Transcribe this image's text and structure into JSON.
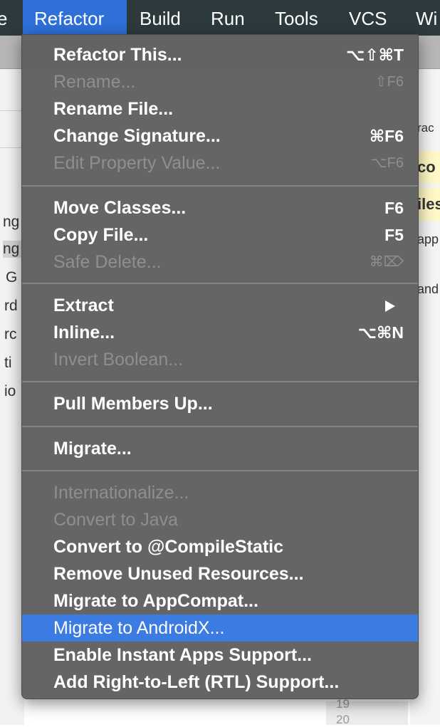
{
  "menubar": {
    "items": [
      {
        "label": "e"
      },
      {
        "label": "Refactor"
      },
      {
        "label": "Build"
      },
      {
        "label": "Run"
      },
      {
        "label": "Tools"
      },
      {
        "label": "VCS"
      },
      {
        "label": "Wi"
      }
    ]
  },
  "background": {
    "left_fragments": [
      "ng",
      "ng",
      "G",
      "rd",
      "rc",
      "ti",
      "io"
    ],
    "right_fragments": [
      "rac",
      "co",
      "iles",
      "app",
      "and"
    ],
    "line_numbers": [
      "19",
      "20"
    ]
  },
  "menu": {
    "items": [
      {
        "label": "Refactor This...",
        "shortcut": "⌥⇧⌘T",
        "disabled": false
      },
      {
        "label": "Rename...",
        "shortcut": "⇧F6",
        "disabled": true
      },
      {
        "label": "Rename File...",
        "shortcut": "",
        "disabled": false
      },
      {
        "label": "Change Signature...",
        "shortcut": "⌘F6",
        "disabled": false
      },
      {
        "label": "Edit Property Value...",
        "shortcut": "⌥F6",
        "disabled": true
      },
      {
        "label": "Move Classes...",
        "shortcut": "F6",
        "disabled": false
      },
      {
        "label": "Copy File...",
        "shortcut": "F5",
        "disabled": false
      },
      {
        "label": "Safe Delete...",
        "shortcut": "⌘⌦",
        "disabled": true
      },
      {
        "label": "Extract",
        "shortcut": "",
        "disabled": false,
        "submenu": true
      },
      {
        "label": "Inline...",
        "shortcut": "⌥⌘N",
        "disabled": false
      },
      {
        "label": "Invert Boolean...",
        "shortcut": "",
        "disabled": true
      },
      {
        "label": "Pull Members Up...",
        "shortcut": "",
        "disabled": false
      },
      {
        "label": "Migrate...",
        "shortcut": "",
        "disabled": false
      },
      {
        "label": "Internationalize...",
        "shortcut": "",
        "disabled": true
      },
      {
        "label": "Convert to Java",
        "shortcut": "",
        "disabled": true
      },
      {
        "label": "Convert to @CompileStatic",
        "shortcut": "",
        "disabled": false
      },
      {
        "label": "Remove Unused Resources...",
        "shortcut": "",
        "disabled": false
      },
      {
        "label": "Migrate to AppCompat...",
        "shortcut": "",
        "disabled": false
      },
      {
        "label": "Migrate to AndroidX...",
        "shortcut": "",
        "disabled": false,
        "highlighted": true
      },
      {
        "label": "Enable Instant Apps Support...",
        "shortcut": "",
        "disabled": false
      },
      {
        "label": "Add Right-to-Left (RTL) Support...",
        "shortcut": "",
        "disabled": false
      }
    ]
  },
  "colors": {
    "menubar_bg": "#2d3a3d",
    "menubar_active": "#2e6fd8",
    "menu_bg": "#606060",
    "menu_highlight": "#3b7be2",
    "text_enabled": "#ffffff",
    "text_disabled": "#8f8f8f"
  }
}
